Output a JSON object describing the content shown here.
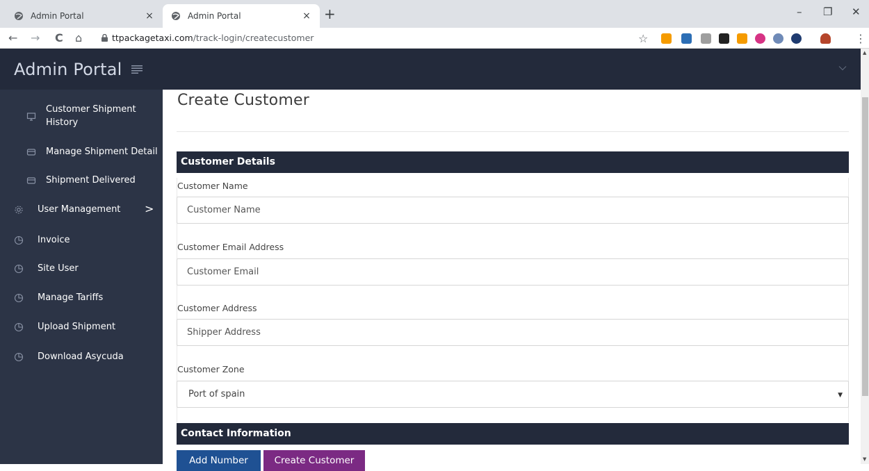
{
  "browser": {
    "tabs": [
      {
        "title": "Admin Portal",
        "close": "×"
      },
      {
        "title": "Admin Portal",
        "close": "×"
      }
    ],
    "new_tab": "+",
    "window_controls": {
      "minimize": "–",
      "maximize": "❐",
      "close": "✕"
    },
    "nav": {
      "back": "←",
      "forward": "→",
      "reload": "C",
      "home": "⌂"
    },
    "url": {
      "domain": "ttpackagetaxi.com",
      "path": "/track-login/createcustomer"
    },
    "bookmark": "☆",
    "menu": "⋮"
  },
  "sidebar": {
    "title": "Admin Portal",
    "items": [
      {
        "label_line1": "Customer Shipment",
        "label_line2": "History",
        "icon": "monitor-icon"
      },
      {
        "label": "Manage Shipment Detail",
        "icon": "card-icon"
      },
      {
        "label": "Shipment Delivered",
        "icon": "card-icon"
      },
      {
        "label": "User Management",
        "icon": "gear-icon",
        "chevron": ">"
      },
      {
        "label": "Invoice",
        "icon": "pie-chart-icon"
      },
      {
        "label": "Site User",
        "icon": "pie-chart-icon"
      },
      {
        "label": "Manage Tariffs",
        "icon": "pie-chart-icon"
      },
      {
        "label": "Upload Shipment",
        "icon": "pie-chart-icon"
      },
      {
        "label": "Download Asycuda",
        "icon": "pie-chart-icon"
      }
    ]
  },
  "main": {
    "page_title": "Create Customer",
    "section_customer": "Customer Details",
    "fields": {
      "name": {
        "label": "Customer Name",
        "placeholder": "Customer Name"
      },
      "email": {
        "label": "Customer Email Address",
        "placeholder": "Customer Email"
      },
      "address": {
        "label": "Customer Address",
        "placeholder": "Shipper Address"
      },
      "zone": {
        "label": "Customer Zone",
        "value": "Port of spain"
      }
    },
    "section_contact": "Contact Information",
    "buttons": {
      "add_number": "Add Number",
      "create_customer": "Create Customer"
    }
  },
  "colors": {
    "sidebar_bg": "#2c3446",
    "header_bg": "#232a3b",
    "add_button": "#1f5193",
    "create_button": "#7b2a83"
  }
}
